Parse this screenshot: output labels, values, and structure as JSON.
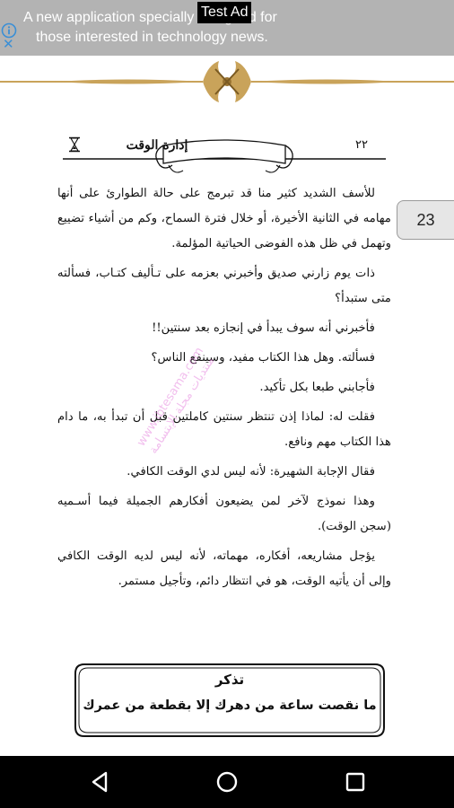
{
  "ad": {
    "label": "Test Ad",
    "line1": "A new application specially designed for",
    "line2": "those interested in technology news.",
    "close_glyph": "✕"
  },
  "reader": {
    "page_badge": "23"
  },
  "book": {
    "chapter_title": "إدارة الوقت",
    "page_number": "٢٢",
    "paragraphs": [
      "للأسف الشديد كثير منا قد تبرمج على حالة الطوارئ على أنها مهامه في الثانية الأخيرة، أو خلال فترة السماح، وكم من أشياء تضييع وتهمل في ظل هذه الفوضى الحياتية المؤلمة.",
      "ذات يوم زارني صديق وأخبرني بعزمه على تـأليف كتـاب، فسألته متى ستبدأ؟",
      "فأخبرني أنه سوف يبدأ في إنجازه بعد سنتين!!",
      "فسألته. وهل هذا الكتاب مفيد، وسينفع الناس؟",
      "فأجابني طبعا بكل تأكيد.",
      "فقلت له: لماذا إذن تنتظر سنتين كاملتين قبل أن تبدأ به، ما دام هذا الكتاب مهم ونافع.",
      "فقال الإجابة الشهيرة: لأنه ليس لدي الوقت الكافي.",
      "وهذا نموذج لآخر لمن يضيعون أفكارهم الجميلة فيما أسـميه (سجن الوقت).",
      "يؤجل مشاريعه، أفكاره، مهماته، لأنه ليس لديه الوقت الكافي وإلى أن يأتيه الوقت، هو في انتظار دائم، وتأجيل مستمر."
    ],
    "watermark_lines": [
      "www.ibtesama.com",
      "منتديات مجلة الإبتسامة"
    ],
    "remember_title": "تذكر",
    "remember_text": "ما نقصت ساعة من دهرك إلا بقطعة من عمرك"
  },
  "colors": {
    "ad_background": "#b3b3b3",
    "ornament_gold": "#c9a35a",
    "ad_info_blue": "#3a8fd6",
    "watermark_pink": "#e78ae0"
  },
  "icons": [
    "info-icon",
    "close-icon",
    "hourglass-icon",
    "back-icon",
    "home-icon",
    "recents-icon"
  ]
}
